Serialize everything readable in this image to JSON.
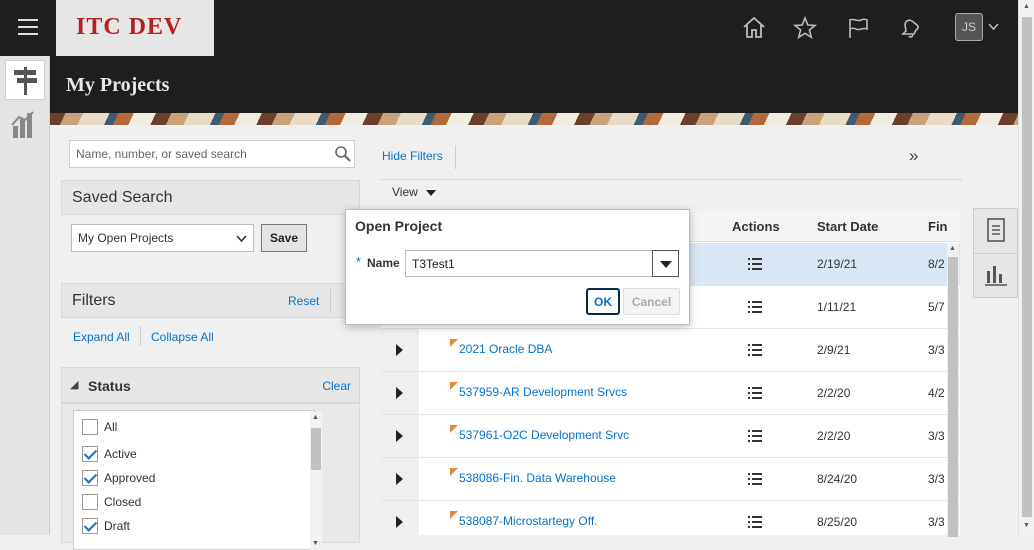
{
  "header": {
    "brand": "ITC DEV",
    "icons": [
      "home-icon",
      "favorites-icon",
      "flag-icon",
      "notifications-bell-icon"
    ],
    "user_initials": "JS"
  },
  "page": {
    "title": "My Projects"
  },
  "search": {
    "placeholder": "Name, number, or saved search"
  },
  "saved_search": {
    "heading": "Saved Search",
    "selected": "My Open Projects",
    "save_label": "Save"
  },
  "filters": {
    "heading": "Filters",
    "reset_label": "Reset",
    "expand_all": "Expand All",
    "collapse_all": "Collapse All",
    "status": {
      "heading": "Status",
      "clear_label": "Clear",
      "options": [
        {
          "label": "All",
          "checked": false
        },
        {
          "label": "Active",
          "checked": true
        },
        {
          "label": "Approved",
          "checked": true
        },
        {
          "label": "Closed",
          "checked": false
        },
        {
          "label": "Draft",
          "checked": true
        }
      ]
    }
  },
  "toolbar": {
    "hide_filters": "Hide Filters",
    "collapse_icon": "»",
    "view_label": "View"
  },
  "table": {
    "columns": {
      "actions": "Actions",
      "start_date": "Start Date",
      "finish_date": "Fin"
    },
    "rows": [
      {
        "name": "",
        "start": "2/19/21",
        "finish": "8/2",
        "selected": true
      },
      {
        "name": "",
        "start": "1/11/21",
        "finish": "5/7",
        "selected": false
      },
      {
        "name": "2021 Oracle DBA",
        "start": "2/9/21",
        "finish": "3/3",
        "selected": false
      },
      {
        "name": "537959-AR Development Srvcs",
        "start": "2/2/20",
        "finish": "4/2",
        "selected": false
      },
      {
        "name": "537961-O2C Development Srvc",
        "start": "2/2/20",
        "finish": "3/3",
        "selected": false
      },
      {
        "name": "538086-Fin. Data Warehouse",
        "start": "8/24/20",
        "finish": "3/3",
        "selected": false
      },
      {
        "name": "538087-Microstartegy Off.",
        "start": "8/25/20",
        "finish": "3/3",
        "selected": false
      }
    ]
  },
  "dialog": {
    "title": "Open Project",
    "required_marker": "*",
    "name_label": "Name",
    "name_value": "T3Test1",
    "ok_label": "OK",
    "cancel_label": "Cancel"
  },
  "colors": {
    "link": "#0572ce",
    "header_bg": "#1e1e1e",
    "brand_red": "#b52020",
    "selected_row": "#d9e7f5"
  }
}
